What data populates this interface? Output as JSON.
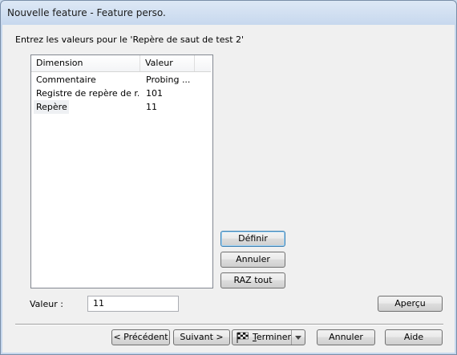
{
  "window": {
    "title": "Nouvelle feature - Feature perso."
  },
  "prompt": "Entrez les valeurs pour le 'Repère de saut de test 2'",
  "grid": {
    "columns": [
      "Dimension",
      "Valeur"
    ],
    "rows": [
      {
        "dimension": "Commentaire",
        "value": "Probing ..."
      },
      {
        "dimension": "Registre de repère de r...",
        "value": "101"
      },
      {
        "dimension": "Repère",
        "value": "11"
      }
    ],
    "selected_index": 2
  },
  "actions": {
    "define": "Définir",
    "cancel_value": "Annuler",
    "reset_all": "RAZ tout",
    "preview": "Aperçu"
  },
  "value_field": {
    "label": "Valeur :",
    "value": "11"
  },
  "footer": {
    "previous": "< Précédent",
    "next": "Suivant >",
    "finish_first": "T",
    "finish_rest": "erminer",
    "cancel": "Annuler",
    "help": "Aide"
  },
  "icons": {
    "finish": "checkered-flag-icon",
    "dropdown": "chevron-down-icon"
  }
}
